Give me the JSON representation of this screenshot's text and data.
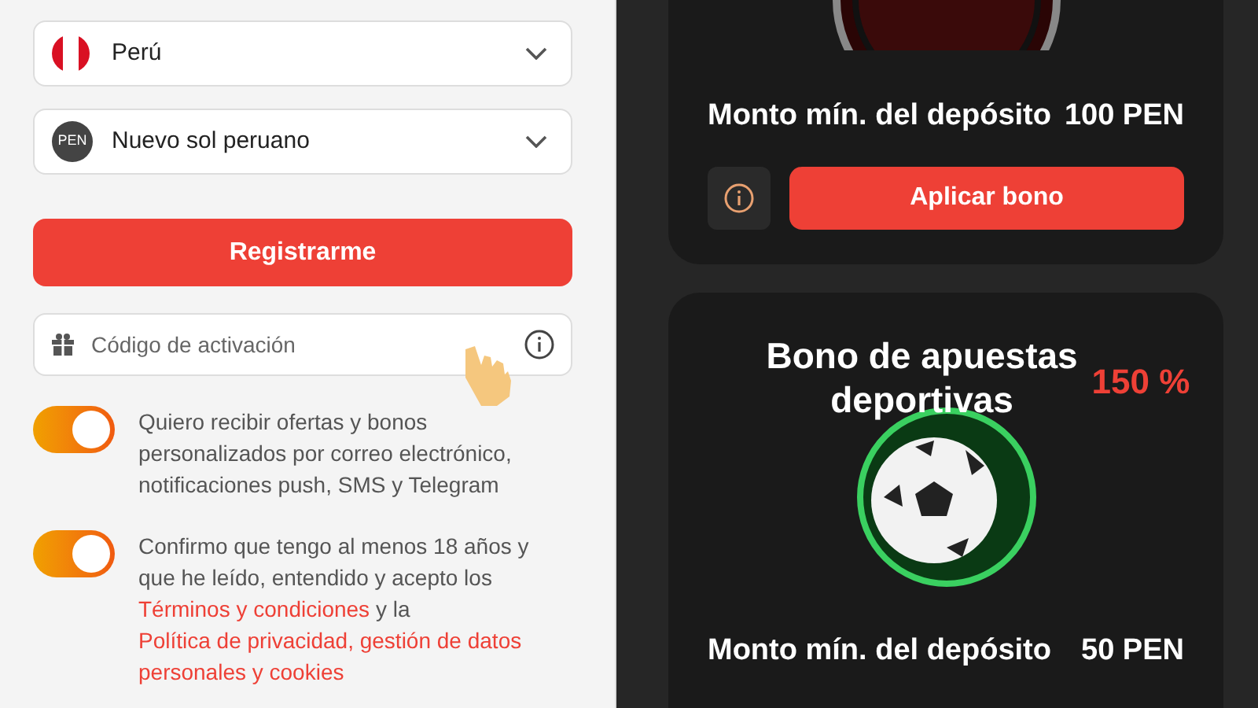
{
  "form": {
    "country": {
      "value": "Perú"
    },
    "currency": {
      "badge": "PEN",
      "value": "Nuevo sol peruano"
    },
    "register_button": "Registrarme",
    "activation_code": {
      "placeholder": "Código de activación"
    },
    "consents": [
      {
        "on": true,
        "text": "Quiero recibir ofertas y bonos personalizados por correo electrónico, notificaciones push, SMS y Telegram"
      },
      {
        "on": true,
        "text": "Confirmo que tengo al menos 18 años y que he leído, entendido y acepto los",
        "link": "Términos y condiciones",
        "joiner": "y la",
        "link_2": "Política de privacidad, gestión de datos personales y cookies"
      }
    ]
  },
  "bonuses": [
    {
      "kind": "casino",
      "min_deposit_label": "Monto mín. del depósito",
      "min_deposit": "100 PEN",
      "apply_button": "Aplicar bono"
    },
    {
      "kind": "sports",
      "title": "Bono de apuestas deportivas",
      "percent": "150 %",
      "min_deposit_label": "Monto mín. del depósito",
      "min_deposit": "50 PEN"
    }
  ]
}
